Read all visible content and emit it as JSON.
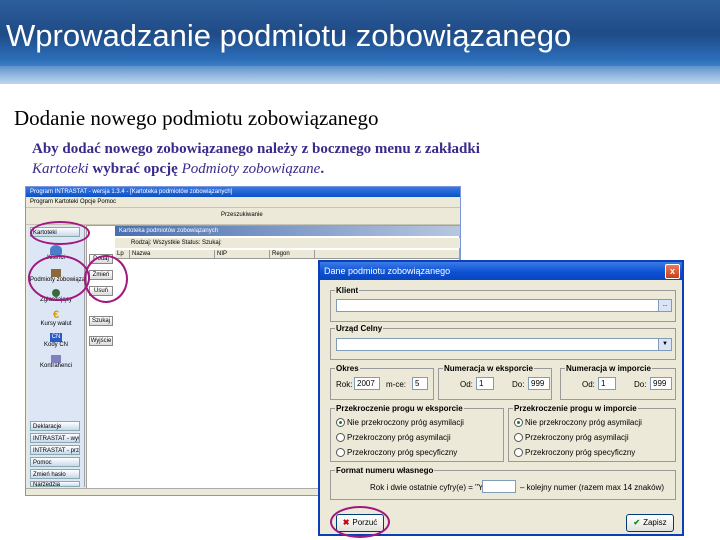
{
  "slide": {
    "title": "Wprowadzanie podmiotu zobowiązanego",
    "subtitle": "Dodanie nowego podmiotu zobowiązanego",
    "desc_part1": "Aby dodać nowego zobowiązanego należy z bocznego menu z zakładki",
    "desc_it1": "Kartoteki",
    "desc_part2": " wybrać opcję ",
    "desc_it2": "Podmioty zobowiązane",
    "desc_end": "."
  },
  "app": {
    "title": "Program INTRASTAT - wersja 1.3.4 - [Kartoteka podmiotów zobowiązanych]",
    "menu": "Program   Kartoteki   Opcje   Pomoc",
    "toolbar_label": "Przeszukiwanie",
    "sidebar": {
      "kartoteki": "Kartoteki",
      "klienci": "Klienci",
      "podmioty": "Podmioty zobowiązane",
      "zglaszajacy": "Zgłaszający",
      "euro": "Kursy walut",
      "cn": "Kody CN",
      "kontrahenci": "Kontrahenci",
      "bottom_items": [
        "Deklaracje",
        "INTRASTAT - wyw",
        "INTRASTAT - przyw",
        "Pomoc",
        "Zmień hasło",
        "Narzędzia"
      ]
    },
    "panel": {
      "header": "Kartoteka podmiotów zobowiązanych",
      "filter": "Rodzaj: Wszystkie    Status:    Szukaj:",
      "columns": [
        "Lp",
        "Nazwa",
        "NIP",
        "Regon"
      ],
      "buttons": [
        "Dodaj",
        "Zmień",
        "Usuń",
        "Szukaj",
        "Wyjście"
      ]
    }
  },
  "dialog": {
    "title": "Dane podmiotu zobowiązanego",
    "close": "x",
    "klient_label": "Klient",
    "urzad_label": "Urząd Celny",
    "okres_label": "Okres",
    "rok_label": "Rok:",
    "rok_value": "2007",
    "miesiac_label": "m-ce:",
    "miesiac_value": "5",
    "eksport_label": "Numeracja w eksporcie",
    "import_label": "Numeracja w imporcie",
    "od_label": "Od:",
    "do_label": "Do:",
    "eks_od": "1",
    "eks_do": "999",
    "imp_od": "1",
    "imp_do": "999",
    "prog_eksport": "Przekroczenie progu w eksporcie",
    "prog_import": "Przekroczenie progu w imporcie",
    "radio_options": [
      "Nie przekroczony próg asymilacji",
      "Przekroczony próg asymilacji",
      "Przekroczony próg specyficzny"
    ],
    "format_label": "Format numeru własnego",
    "format_text_left": "Rok i dwie ostatnie cyfry(e) = \"YY\" –",
    "format_text_right": "– kolejny numer (razem max 14 znaków)",
    "cancel_button": "Porzuć",
    "ok_button": "Zapisz"
  }
}
